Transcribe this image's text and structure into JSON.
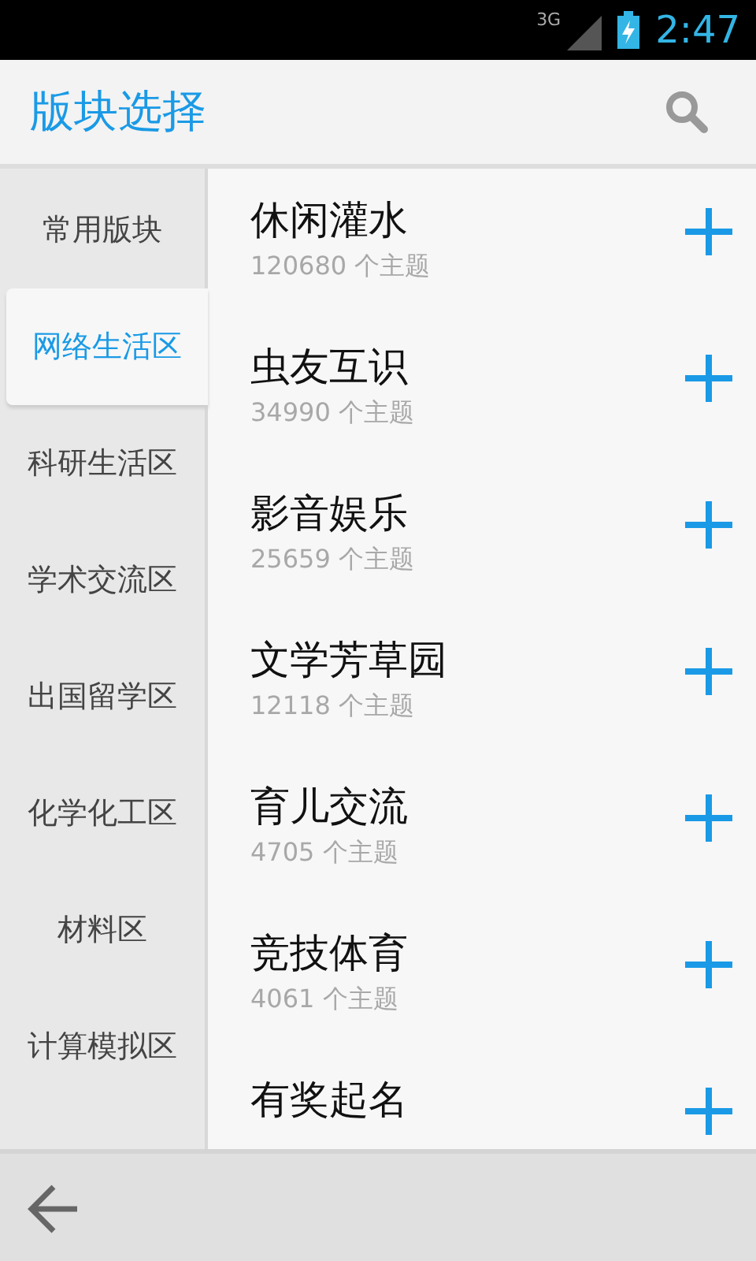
{
  "status_bar": {
    "network": "3G",
    "time": "2:47"
  },
  "app_bar": {
    "title": "版块选择"
  },
  "sidebar": {
    "items": [
      {
        "label": "常用版块",
        "selected": false
      },
      {
        "label": "网络生活区",
        "selected": true
      },
      {
        "label": "科研生活区",
        "selected": false
      },
      {
        "label": "学术交流区",
        "selected": false
      },
      {
        "label": "出国留学区",
        "selected": false
      },
      {
        "label": "化学化工区",
        "selected": false
      },
      {
        "label": "材料区",
        "selected": false
      },
      {
        "label": "计算模拟区",
        "selected": false
      }
    ]
  },
  "boards": [
    {
      "name": "休闲灌水",
      "count": "120680 个主题"
    },
    {
      "name": "虫友互识",
      "count": "34990 个主题"
    },
    {
      "name": "影音娱乐",
      "count": "25659 个主题"
    },
    {
      "name": "文学芳草园",
      "count": "12118 个主题"
    },
    {
      "name": "育儿交流",
      "count": "4705 个主题"
    },
    {
      "name": "竞技体育",
      "count": "4061 个主题"
    },
    {
      "name": "有奖起名"
    }
  ]
}
